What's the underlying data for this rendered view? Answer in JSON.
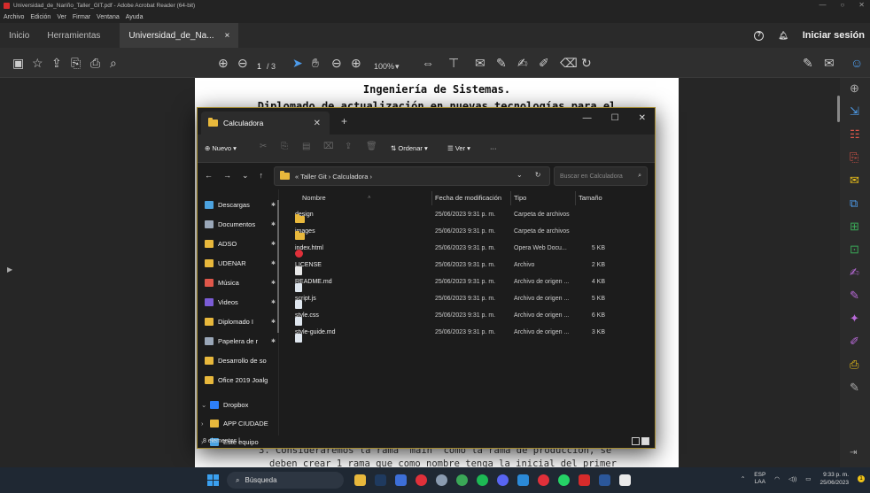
{
  "acrobat": {
    "window_title": "Universidad_de_Nariño_Taller_GIT.pdf - Adobe Acrobat Reader (64-bit)",
    "menu": [
      "Archivo",
      "Edición",
      "Ver",
      "Firmar",
      "Ventana",
      "Ayuda"
    ],
    "tabs": {
      "home": "Inicio",
      "tools": "Herramientas",
      "document": "Universidad_de_Na...",
      "close": "×"
    },
    "signin": "Iniciar sesión",
    "help": "?",
    "bell": "♪",
    "toolbar": {
      "page_current": "1",
      "page_total": "/ 3",
      "zoom": "100%"
    }
  },
  "pdf_page": {
    "heading": "Ingeniería de Sistemas.",
    "subheading": "Diplomado de actualización en nuevas tecnologías para el",
    "item3_line1": "3. Consideraremos la rama \"main\" como la rama de producción, se",
    "item3_line2": "deben crear 1 rama que como nombre tenga la inicial del primer"
  },
  "explorer": {
    "tab_title": "Calculadora",
    "new_tab": "+",
    "window_controls": [
      "—",
      "☐",
      "✕"
    ],
    "commands": {
      "new": "Nuevo",
      "sort": "Ordenar",
      "view": "Ver",
      "more": "···"
    },
    "breadcrumb": "«  Taller Git  ›  Calculadora  ›",
    "search_placeholder": "Buscar en Calculadora",
    "nav": [
      {
        "label": "Descargas",
        "icon": "download-icon",
        "color": "#4ca3e0"
      },
      {
        "label": "Documentos",
        "icon": "documents-icon",
        "color": "#9aa7b8"
      },
      {
        "label": "ADSO",
        "icon": "folder-icon",
        "color": "#e8b83c"
      },
      {
        "label": "UDENAR",
        "icon": "folder-icon",
        "color": "#e8b83c"
      },
      {
        "label": "Música",
        "icon": "music-icon",
        "color": "#e0574a"
      },
      {
        "label": "Videos",
        "icon": "videos-icon",
        "color": "#7b5cd6"
      },
      {
        "label": "Diplomado I",
        "icon": "folder-icon",
        "color": "#e8b83c"
      },
      {
        "label": "Papelera de r",
        "icon": "recycle-bin-icon",
        "color": "#9aa7b8"
      },
      {
        "label": "Desarrollo de so",
        "icon": "folder-icon",
        "color": "#e8b83c"
      },
      {
        "label": "Ofice 2019 Joalg",
        "icon": "folder-icon",
        "color": "#e8b83c"
      }
    ],
    "nav_tree": [
      {
        "label": "Dropbox",
        "icon": "dropbox-icon",
        "color": "#2d7ff9",
        "arrow": "⌄"
      },
      {
        "label": "APP CIUDADE",
        "icon": "folder-icon",
        "color": "#e8b83c",
        "arrow": "›"
      },
      {
        "label": "Este equipo",
        "icon": "computer-icon",
        "color": "#4ca3e0",
        "arrow": "›"
      }
    ],
    "columns": {
      "name": "Nombre",
      "modified": "Fecha de modificación",
      "type": "Tipo",
      "size": "Tamaño"
    },
    "files": [
      {
        "name": "design",
        "date": "25/06/2023 9:31 p. m.",
        "type": "Carpeta de archivos",
        "size": "",
        "icon": "folder-icon",
        "color": "#e8b83c"
      },
      {
        "name": "images",
        "date": "25/06/2023 9:31 p. m.",
        "type": "Carpeta de archivos",
        "size": "",
        "icon": "folder-icon",
        "color": "#e8b83c"
      },
      {
        "name": "index.html",
        "date": "25/06/2023 9:31 p. m.",
        "type": "Opera Web Docu...",
        "size": "5 KB",
        "icon": "opera-icon",
        "color": "#e0303a"
      },
      {
        "name": "LICENSE",
        "date": "25/06/2023 9:31 p. m.",
        "type": "Archivo",
        "size": "2 KB",
        "icon": "file-icon",
        "color": "#e8e8e8"
      },
      {
        "name": "README.md",
        "date": "25/06/2023 9:31 p. m.",
        "type": "Archivo de origen ...",
        "size": "4 KB",
        "icon": "code-file-icon",
        "color": "#dfe6ee"
      },
      {
        "name": "script.js",
        "date": "25/06/2023 9:31 p. m.",
        "type": "Archivo de origen ...",
        "size": "5 KB",
        "icon": "code-file-icon",
        "color": "#dfe6ee"
      },
      {
        "name": "style.css",
        "date": "25/06/2023 9:31 p. m.",
        "type": "Archivo de origen ...",
        "size": "6 KB",
        "icon": "code-file-icon",
        "color": "#dfe6ee"
      },
      {
        "name": "style-guide.md",
        "date": "25/06/2023 9:31 p. m.",
        "type": "Archivo de origen ...",
        "size": "3 KB",
        "icon": "code-file-icon",
        "color": "#dfe6ee"
      }
    ],
    "status": "8 elementos  |"
  },
  "taskbar": {
    "search": "Búsqueda",
    "apps": [
      {
        "name": "file-explorer-icon",
        "color": "#e8b83c"
      },
      {
        "name": "photoshop-icon",
        "color": "#1f3a5f"
      },
      {
        "name": "app-icon",
        "color": "#3d6fd8"
      },
      {
        "name": "opera-gx-icon",
        "color": "#e0303a"
      },
      {
        "name": "settings-icon",
        "color": "#8a9bb0"
      },
      {
        "name": "chrome-icon",
        "color": "#3aa757"
      },
      {
        "name": "spotify-icon",
        "color": "#1db954"
      },
      {
        "name": "discord-icon",
        "color": "#5865f2"
      },
      {
        "name": "vscode-icon",
        "color": "#2b8ad8"
      },
      {
        "name": "opera-icon",
        "color": "#e0303a"
      },
      {
        "name": "whatsapp-icon",
        "color": "#25d366"
      },
      {
        "name": "acrobat-icon",
        "color": "#d62b2b"
      },
      {
        "name": "word-icon",
        "color": "#2b579a"
      },
      {
        "name": "document-icon",
        "color": "#eaeaea"
      }
    ],
    "lang_top": "ESP",
    "lang_bottom": "LAA",
    "time": "9:33 p. m.",
    "date": "25/06/2023",
    "notifications": "1"
  }
}
